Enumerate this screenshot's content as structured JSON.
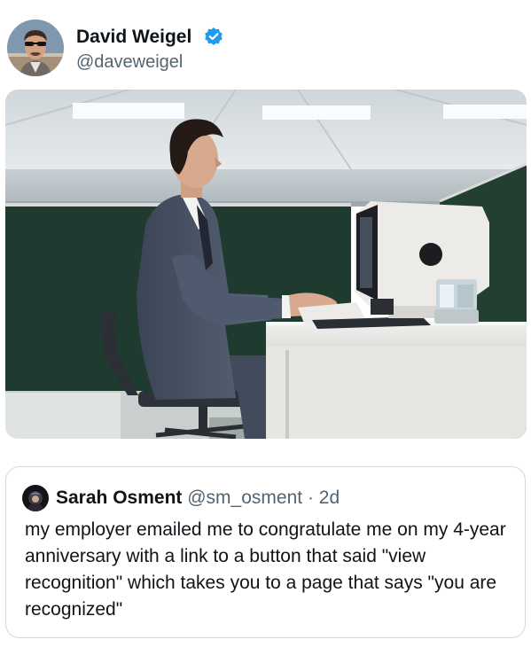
{
  "tweet": {
    "author": {
      "name": "David Weigel",
      "handle": "@daveweigel",
      "verified": true,
      "verified_color": "#1d9bf0"
    },
    "media": {
      "scene_colors": {
        "ceiling": "#d7dcdf",
        "light_panel": "#f7fbff",
        "wall": "#bac3c7",
        "partition": "#203a2f",
        "desk": "#e8e8e6",
        "suit": "#4a5566",
        "monitor": "#eceae6"
      }
    },
    "quoted": {
      "author_name": "Sarah Osment",
      "handle": "@sm_osment",
      "separator": "·",
      "time": "2d",
      "text": "my employer emailed me to congratulate me on my 4-year anniversary with a link to a button that said \"view recognition\" which takes you to a page that says \"you are recognized\""
    }
  }
}
